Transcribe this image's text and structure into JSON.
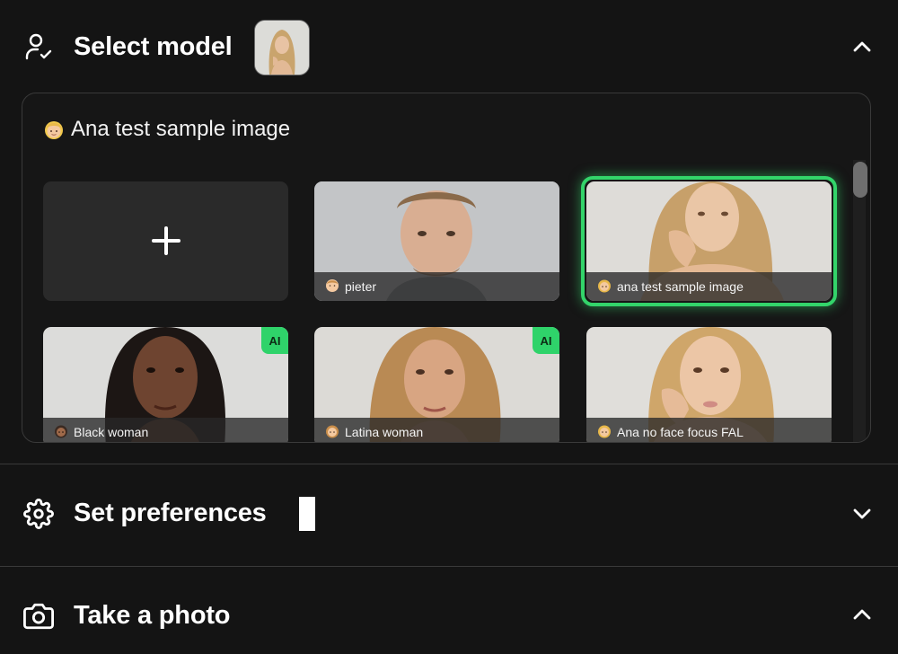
{
  "sections": {
    "select_model": {
      "title": "Select model",
      "expanded": true
    },
    "preferences": {
      "title": "Set preferences",
      "expanded": false
    },
    "photo": {
      "title": "Take a photo",
      "expanded": true
    }
  },
  "panel": {
    "title": "Ana test sample image",
    "cards": [
      {
        "type": "add",
        "label": "+"
      },
      {
        "label": "pieter",
        "ai": false,
        "selected": false
      },
      {
        "label": "ana test sample image",
        "ai": false,
        "selected": true
      },
      {
        "label": "Black woman",
        "ai": true,
        "ai_text": "AI",
        "selected": false
      },
      {
        "label": "Latina woman",
        "ai": true,
        "ai_text": "AI",
        "selected": false
      },
      {
        "label": "Ana no face focus FAL",
        "ai": false,
        "selected": false
      }
    ]
  },
  "colors": {
    "accent": "#33d46a",
    "background": "#141414",
    "panel_border": "#3a3a3a"
  },
  "icons": {
    "select_model": "user-check-icon",
    "preferences": "gear-icon",
    "photo": "camera-icon",
    "collapse": "chevron-up-icon",
    "expand": "chevron-down-icon"
  }
}
